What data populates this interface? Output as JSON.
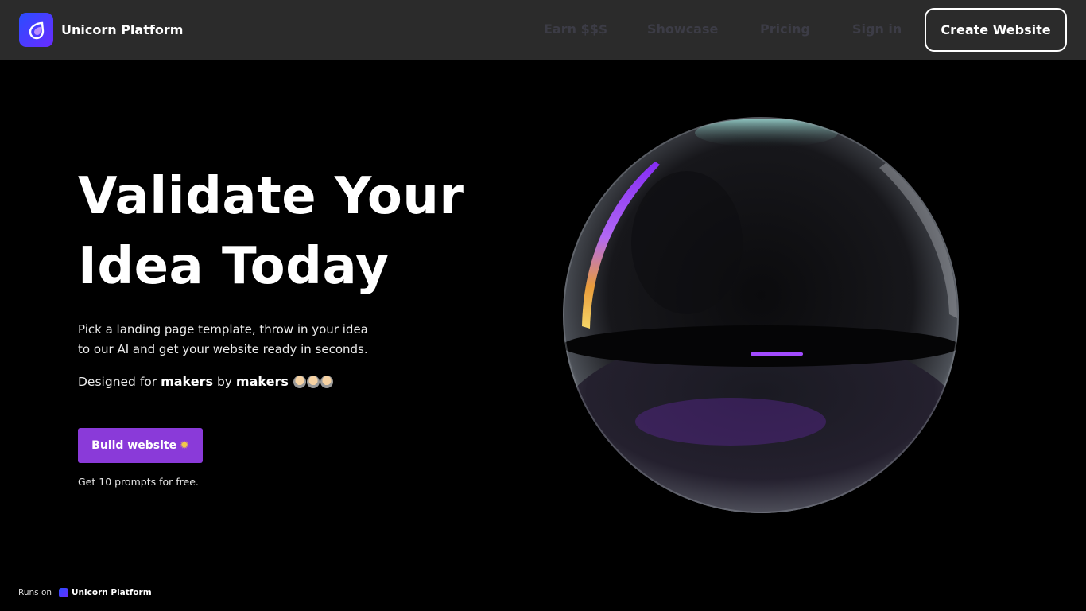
{
  "header": {
    "brand_name": "Unicorn Platform",
    "nav": [
      {
        "label": "Earn $$$"
      },
      {
        "label": "Showcase"
      },
      {
        "label": "Pricing"
      },
      {
        "label": "Sign in"
      }
    ],
    "cta_label": "Create Website"
  },
  "hero": {
    "title_line1": "Validate Your",
    "title_line2": "Idea Today",
    "subtitle_line1": "Pick a landing page template, throw in your idea",
    "subtitle_line2": "to our AI and get your website ready in seconds.",
    "makers_prefix": "Designed for",
    "makers_word1": "makers",
    "makers_mid": "by",
    "makers_word2": "makers",
    "makers_emoji_icon": "maker-emoji-group",
    "button_label": "Build website",
    "button_icon": "dizzy-star-icon",
    "free_note": "Get 10 prompts for free."
  },
  "footer": {
    "runs_on_prefix": "Runs on",
    "runs_on_brand": "Unicorn Platform"
  },
  "colors": {
    "header_bg": "#2b2b2b",
    "page_bg": "#000000",
    "accent_button": "#8a3ad9",
    "nav_text": "#3c3c46",
    "logo_gradient_start": "#2a4dff",
    "logo_gradient_end": "#6a2bff"
  }
}
